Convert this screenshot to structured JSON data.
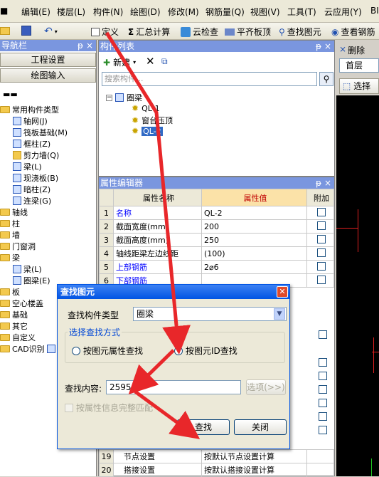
{
  "menubar": {
    "items": [
      "编辑(E)",
      "楼层(L)",
      "构件(N)",
      "绘图(D)",
      "修改(M)",
      "钢筋量(Q)",
      "视图(V)",
      "工具(T)",
      "云应用(Y)",
      "BI"
    ]
  },
  "toolbar": {
    "define": "定义",
    "summary": "汇总计算",
    "cloud_check": "云检查",
    "flush_slab": "平齐板顶",
    "find_element": "查找图元",
    "view_rebar": "查看钢筋"
  },
  "nav": {
    "title": "导航栏",
    "btn_project": "工程设置",
    "btn_draw": "绘图输入",
    "tree": [
      "常用构件类型",
      "轴网(J)",
      "筏板基础(M)",
      "框柱(Z)",
      "剪力墙(Q)",
      "梁(L)",
      "现浇板(B)",
      "暗柱(Z)",
      "连梁(G)",
      "轴线",
      "柱",
      "墙",
      "门窗洞",
      "梁",
      "梁(L)",
      "圈梁(E)",
      "板",
      "空心楼盖",
      "基础",
      "其它",
      "自定义",
      "CAD识别"
    ]
  },
  "complist": {
    "title": "构件列表",
    "new_label": "新建",
    "search_placeholder": "搜索构件...",
    "root": "圈梁",
    "items": [
      "QL-1",
      "窗台压顶",
      "QL-2"
    ]
  },
  "propeditor": {
    "title": "属性编辑器",
    "col_name": "属性名称",
    "col_value": "属性值",
    "col_extra": "附加",
    "rows": [
      {
        "n": "1",
        "name": "名称",
        "value": "QL-2"
      },
      {
        "n": "2",
        "name": "截面宽度(mm)",
        "value": "200"
      },
      {
        "n": "3",
        "name": "截面高度(mm)",
        "value": "250"
      },
      {
        "n": "4",
        "name": "轴线距梁左边线距",
        "value": "(100)"
      },
      {
        "n": "5",
        "name": "上部钢筋",
        "value": "2⌀6"
      },
      {
        "n": "6",
        "name": "下部钢筋",
        "value": ""
      }
    ],
    "bottom_rows": [
      {
        "n": "19",
        "name": "节点设置",
        "value": "按默认节点设置计算"
      },
      {
        "n": "20",
        "name": "搭接设置",
        "value": "按默认搭接设置计算"
      }
    ]
  },
  "rightbar": {
    "delete": "删除",
    "floor": "首层",
    "select": "选择"
  },
  "dialog": {
    "title": "查找图元",
    "type_label": "查找构件类型",
    "type_value": "圈梁",
    "group_title": "选择查找方式",
    "radio_attr": "按图元属性查找",
    "radio_id": "按图元ID查找",
    "content_label": "查找内容:",
    "content_value": "2595",
    "options_btn": "选项(>>)",
    "complete_match": "按属性信息完整匹配",
    "find_btn": "查找",
    "close_btn": "关闭"
  },
  "colors": {
    "panel_header": "#7a96df",
    "arrow": "#e8272a",
    "value_header_bg": "#fbe2a8"
  }
}
